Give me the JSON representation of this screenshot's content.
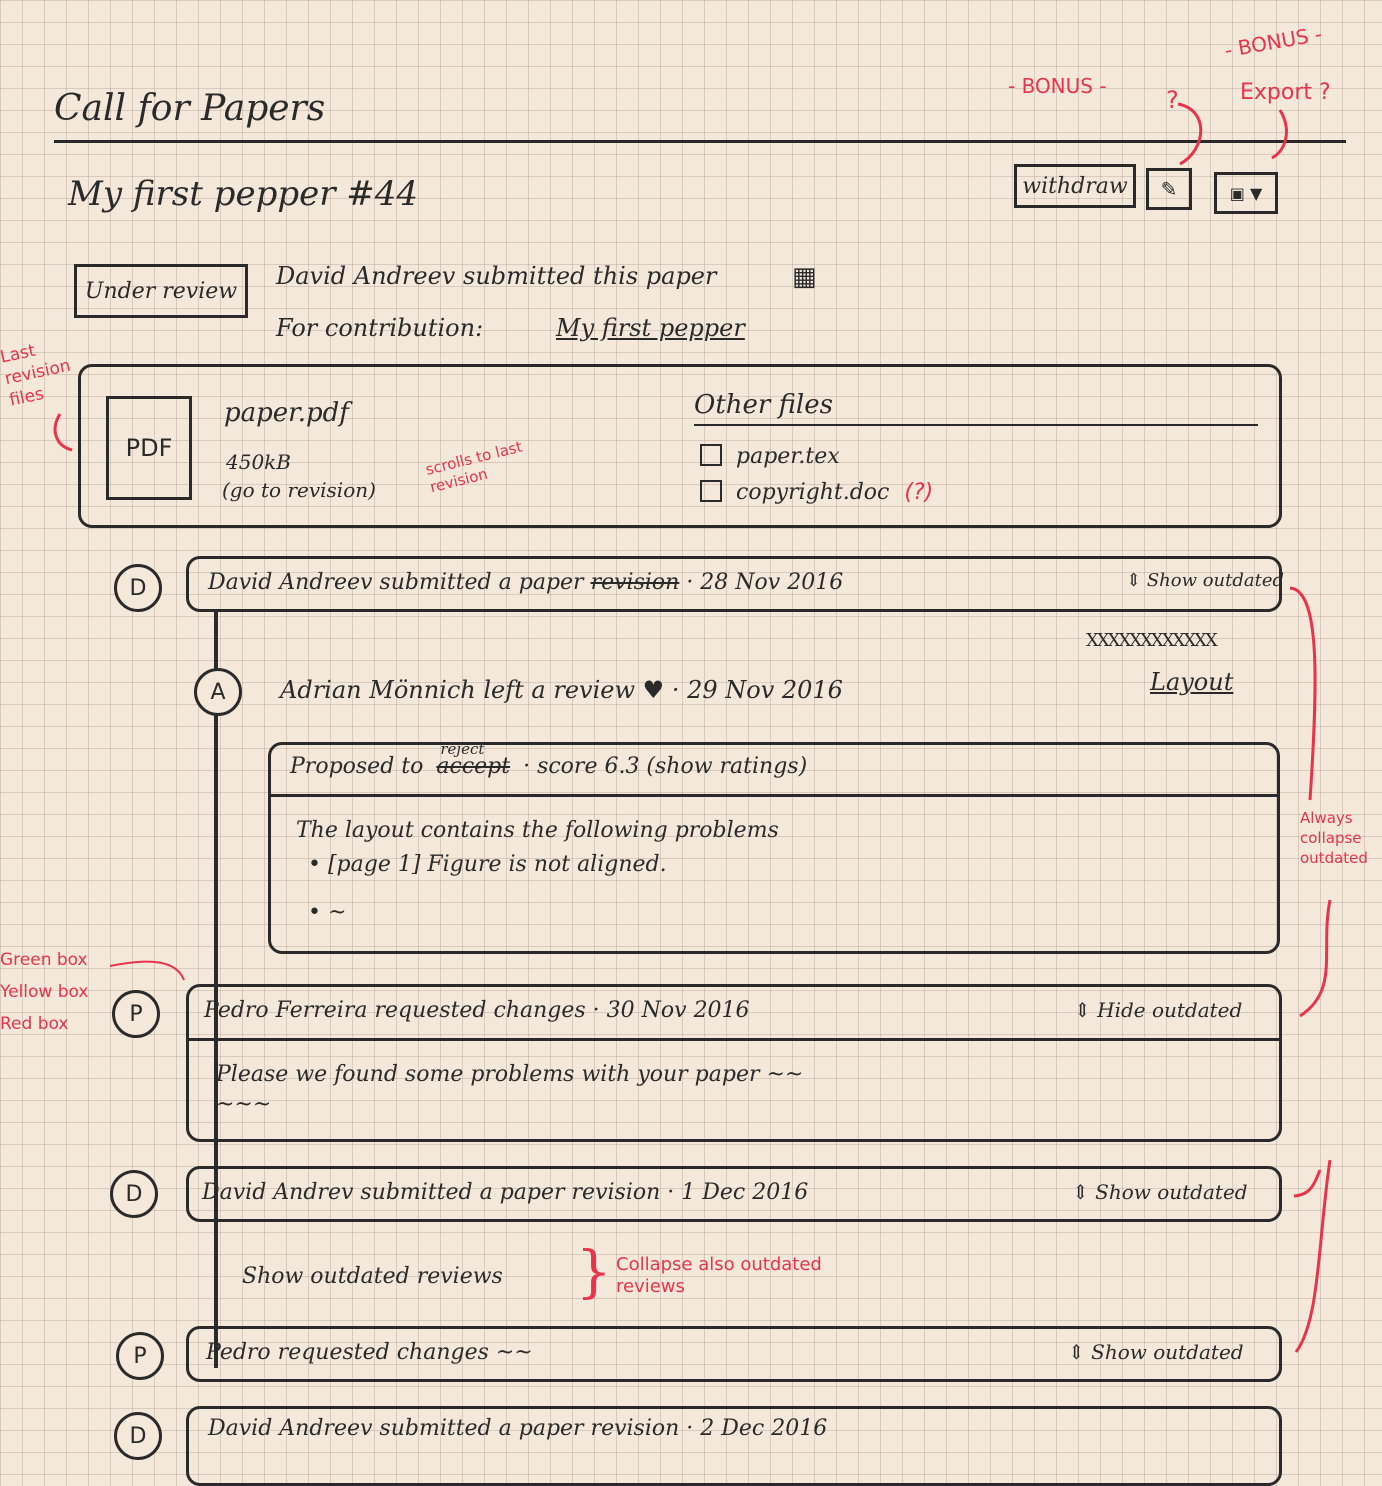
{
  "header": {
    "title": "Call for Papers",
    "bonus_left": "- BONUS -",
    "bonus_right": "- BONUS -",
    "question": "?",
    "export_note": "Export ?"
  },
  "paper": {
    "title": "My first pepper #44",
    "withdraw_label": "withdraw",
    "edit_icon": "pencil-icon",
    "export_icon": "export-dropdown-icon",
    "status": "Under review",
    "submitted_by": "David Andreev submitted this paper",
    "contribution_label": "For contribution:",
    "contribution_link": "My first pepper"
  },
  "files": {
    "side_note": "Last revision files",
    "pdf_badge": "PDF",
    "main_file": "paper.pdf",
    "main_size": "450kB",
    "go_to_revision": "(go to revision)",
    "scroll_note": "scrolls to last revision",
    "other_title": "Other files",
    "other": [
      {
        "name": "paper.tex",
        "note": ""
      },
      {
        "name": "copyright.doc",
        "note": "(?)"
      }
    ]
  },
  "timeline": [
    {
      "avatar": "D",
      "text": "David Andreev submitted a paper",
      "struck": "revision",
      "date": "· 28 Nov 2016",
      "toggle": "Show outdated"
    },
    {
      "avatar": "A",
      "text": "Adrian Mönnich left a review",
      "date": "· 29 Nov 2016",
      "category": "Layout",
      "proposal_label": "Proposed to",
      "proposal_new": "reject",
      "proposal_old": "accept",
      "score": "· score 6.3 (show ratings)",
      "body_line1": "The layout contains the following problems",
      "body_line2": "• [page 1] Figure is not aligned.",
      "body_line3": "• ~"
    },
    {
      "avatar": "P",
      "text": "Pedro Ferreira requested changes",
      "date": "· 30 Nov 2016",
      "toggle": "Hide outdated",
      "body": "Please we found some problems with your paper ~~",
      "body2": "~~~"
    },
    {
      "avatar": "D",
      "text": "David Andrev submitted a paper revision",
      "date": "· 1 Dec 2016",
      "toggle": "Show outdated"
    },
    {
      "outdated_label": "Show outdated reviews",
      "collapse_note": "Collapse also outdated reviews"
    },
    {
      "avatar": "P",
      "text": "Pedro requested changes ~~",
      "toggle": "Show outdated"
    },
    {
      "avatar": "D",
      "text": "David Andreev submitted a paper revision",
      "date": "· 2 Dec 2016"
    }
  ],
  "annotations": {
    "always_collapse": "Always collapse outdated",
    "box_colors": [
      "Green box",
      "Yellow box",
      "Red box"
    ]
  },
  "colors": {
    "ink": "#2a2a2a",
    "annotation": "#e8334b",
    "paper": "#f3e8da"
  }
}
